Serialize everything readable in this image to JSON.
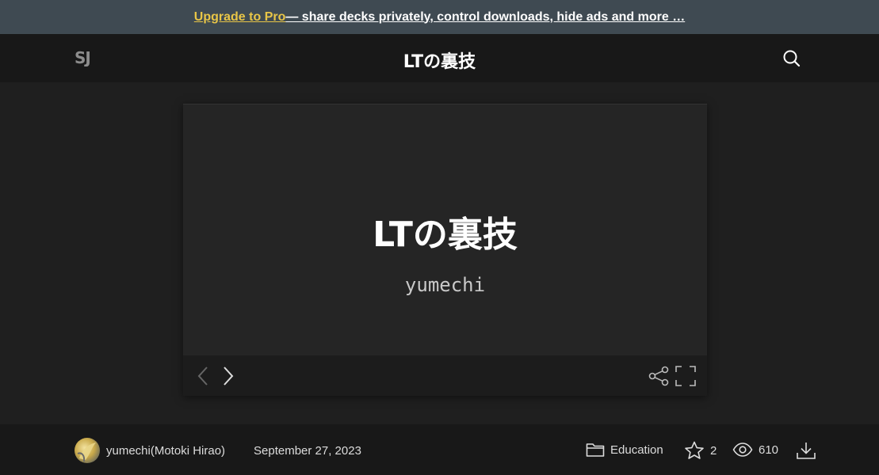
{
  "promo": {
    "link_label": "Upgrade to Pro",
    "text": " — share decks privately, control downloads, hide ads and more …"
  },
  "header": {
    "logo_text": "SJ",
    "title": "LTの裏技"
  },
  "slide": {
    "title": "LTの裏技",
    "author": "yumechi"
  },
  "footer": {
    "author_name": "yumechi(Motoki Hirao)",
    "date": "September 27, 2023",
    "category": "Education",
    "stars": "2",
    "views": "610"
  },
  "colors": {
    "promo_bg": "#3f4a52",
    "pro_accent": "#e8c547",
    "page_bg": "#1f1f1f",
    "bar_bg": "#181818"
  },
  "icons": [
    "logo-icon",
    "search-icon",
    "prev-icon",
    "next-icon",
    "share-icon",
    "fullscreen-icon",
    "folder-icon",
    "star-icon",
    "eye-icon",
    "download-icon"
  ]
}
